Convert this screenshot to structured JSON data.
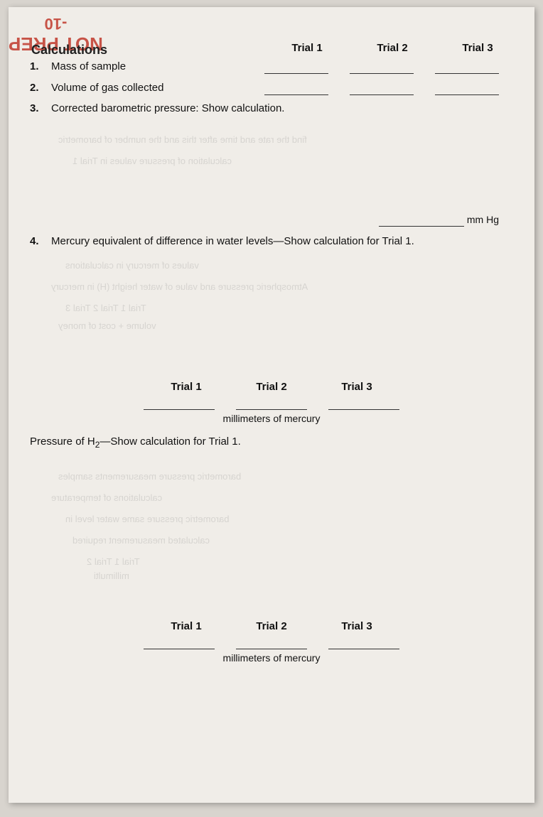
{
  "watermark": {
    "text": "NOT PREP",
    "not_text": "NOT PREP",
    "subtitle": "-10"
  },
  "header": {
    "title": "Calculations"
  },
  "trials": {
    "t1": "Trial 1",
    "t2": "Trial 2",
    "t3": "Trial 3"
  },
  "questions": {
    "q1": {
      "number": "1.",
      "text": "Mass of sample"
    },
    "q2": {
      "number": "2.",
      "text": "Volume of gas collected"
    },
    "q3": {
      "number": "3.",
      "text": "Corrected barometric pressure: Show calculation."
    },
    "q3_unit": "mm Hg",
    "q4": {
      "number": "4.",
      "text": "Mercury equivalent of difference in water levels—Show calculation for Trial 1."
    }
  },
  "mid_section": {
    "unit": "millimeters of mercury",
    "pressure_label": "Pressure of H",
    "pressure_sub": "2",
    "pressure_suffix": "—Show calculation for Trial 1."
  },
  "bottom_section": {
    "unit": "millimeters of mercury"
  }
}
